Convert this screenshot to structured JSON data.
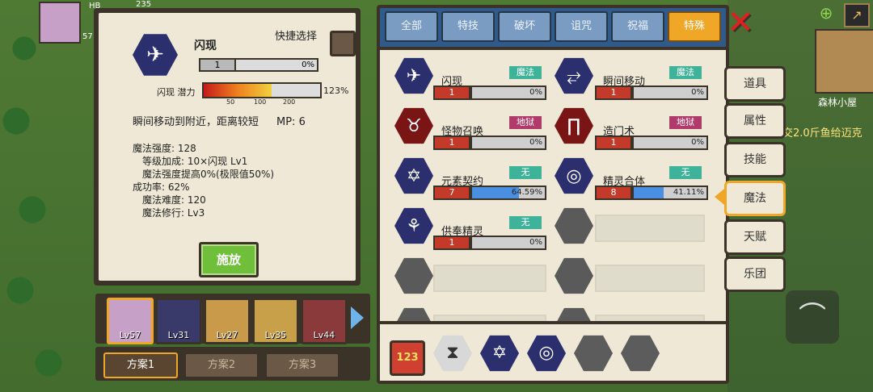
{
  "hud": {
    "hp_label": "HB",
    "hp_value": "235",
    "level_small": "57",
    "map_location": "森林小屋",
    "quest_text": "交2.0斤鱼给迈克"
  },
  "detail": {
    "skill_name": "闪现",
    "quick_select_label": "快捷选择",
    "level_value": "1",
    "level_percent": "0%",
    "potential_label": "闪现 潜力",
    "potential_percent": "123%",
    "potential_fill": 1.23,
    "potential_ticks": [
      "50",
      "100",
      "200"
    ],
    "description": "瞬间移动到附近，距离较短",
    "mp_text": "MP: 6",
    "stats": [
      "魔法强度: 128",
      "等级加成: 10×闪现 Lv1",
      "魔法强度提高0%(极限值50%)",
      "成功率: 62%",
      "魔法难度: 120",
      "魔法修行: Lv3"
    ],
    "cast_label": "施放"
  },
  "tabs": [
    {
      "label": "全部"
    },
    {
      "label": "特技"
    },
    {
      "label": "破坏"
    },
    {
      "label": "诅咒"
    },
    {
      "label": "祝福"
    },
    {
      "label": "特殊"
    }
  ],
  "skills": [
    {
      "name": "闪现",
      "tag": "魔法",
      "tag_color": "#3fb39a",
      "level": "1",
      "percent": "0%",
      "fill": 0.0,
      "icon": "dash-icon"
    },
    {
      "name": "瞬间移动",
      "tag": "魔法",
      "tag_color": "#3fb39a",
      "level": "1",
      "percent": "0%",
      "fill": 0.0,
      "icon": "teleport-icon"
    },
    {
      "name": "怪物召唤",
      "tag": "地狱",
      "tag_color": "#b03a6a",
      "level": "1",
      "percent": "0%",
      "fill": 0.0,
      "icon": "demon-icon"
    },
    {
      "name": "造门术",
      "tag": "地狱",
      "tag_color": "#b03a6a",
      "level": "1",
      "percent": "0%",
      "fill": 0.0,
      "icon": "gate-icon"
    },
    {
      "name": "元素契约",
      "tag": "无",
      "tag_color": "#3fb39a",
      "level": "7",
      "percent": "64.59%",
      "fill": 0.6459,
      "icon": "pentagram-icon"
    },
    {
      "name": "精灵合体",
      "tag": "无",
      "tag_color": "#3fb39a",
      "level": "8",
      "percent": "41.11%",
      "fill": 0.4111,
      "icon": "spirit-icon"
    },
    {
      "name": "供奉精灵",
      "tag": "无",
      "tag_color": "#3fb39a",
      "level": "1",
      "percent": "0%",
      "fill": 0.0,
      "icon": "offering-icon"
    }
  ],
  "side_tabs": [
    {
      "label": "道具"
    },
    {
      "label": "属性"
    },
    {
      "label": "技能"
    },
    {
      "label": "魔法"
    },
    {
      "label": "天赋"
    },
    {
      "label": "乐团"
    }
  ],
  "party": [
    {
      "level": "Lv57",
      "color": "#c7a0c8"
    },
    {
      "level": "Lv31",
      "color": "#3a3a6a"
    },
    {
      "level": "Lv27",
      "color": "#c89a4a"
    },
    {
      "level": "Lv35",
      "color": "#c8a04a"
    },
    {
      "level": "Lv44",
      "color": "#8a3a3a"
    }
  ],
  "plans": [
    {
      "label": "方案1"
    },
    {
      "label": "方案2"
    },
    {
      "label": "方案3"
    }
  ],
  "colors": {
    "accent": "#f0a727",
    "panel_border": "#3b3228",
    "panel_bg": "#efe8d6",
    "tab_blue": "#7a9cc2"
  }
}
